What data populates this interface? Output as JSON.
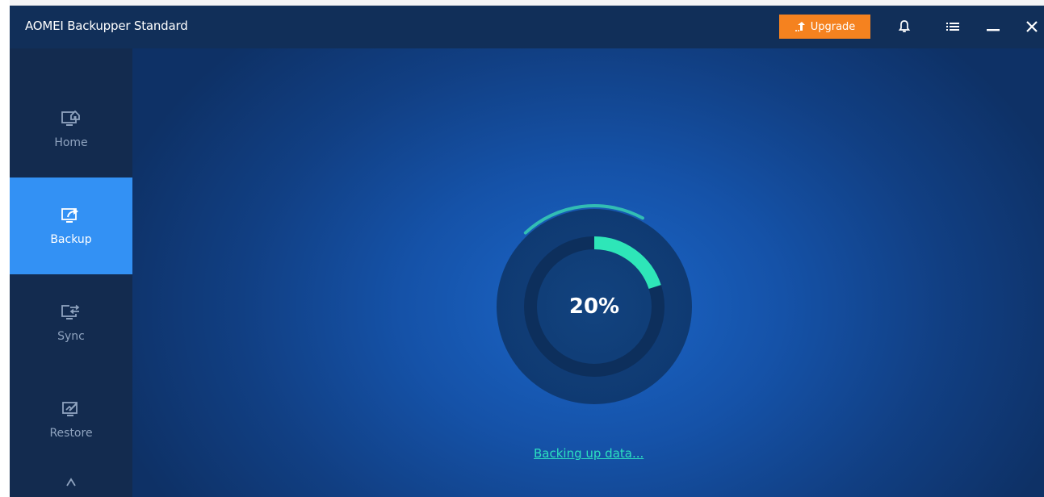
{
  "app": {
    "title": "AOMEI Backupper Standard"
  },
  "titlebar": {
    "upgrade_label": "Upgrade",
    "upgrade_color": "#f5821f",
    "icons": [
      "bell-icon",
      "menu-icon",
      "minimize-icon",
      "close-icon"
    ]
  },
  "sidebar": {
    "items": [
      {
        "label": "Home",
        "icon": "home-monitor-icon",
        "active": false
      },
      {
        "label": "Backup",
        "icon": "backup-monitor-icon",
        "active": true
      },
      {
        "label": "Sync",
        "icon": "sync-monitor-icon",
        "active": false
      },
      {
        "label": "Restore",
        "icon": "restore-monitor-icon",
        "active": false
      }
    ],
    "active_color": "#3391f4"
  },
  "main": {
    "progress": {
      "percent_label": "20%",
      "fraction": 0.2,
      "arc_color": "#2ee6b8"
    },
    "status_text": "Backing up data...",
    "status_color": "#2ce0c0"
  }
}
